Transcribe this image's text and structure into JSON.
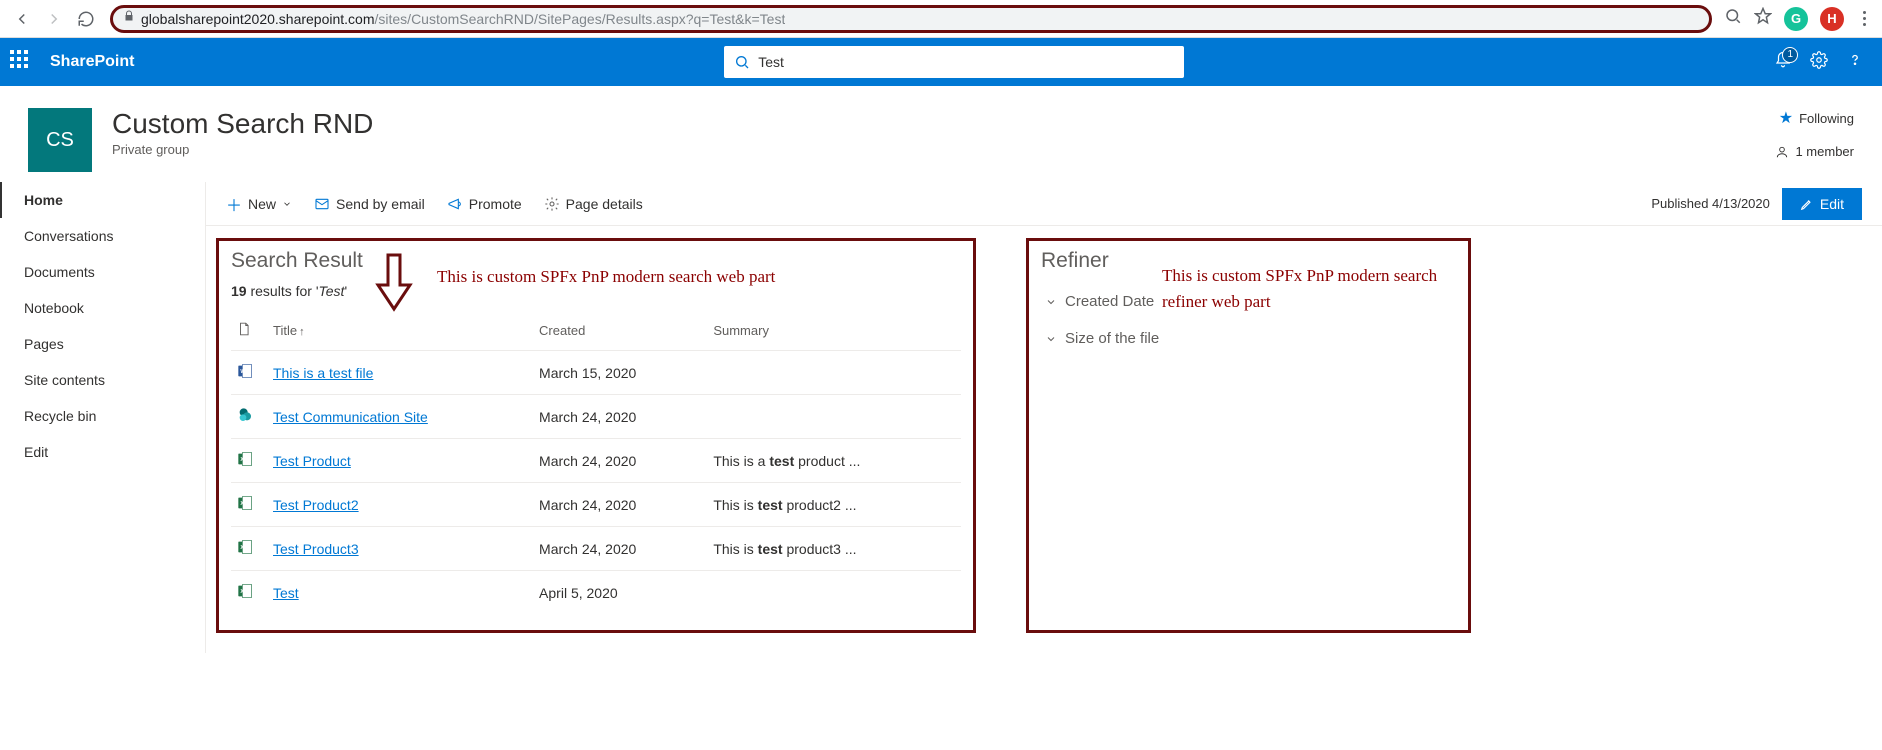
{
  "browser": {
    "url_host": "globalsharepoint2020.sharepoint.com",
    "url_path": "/sites/CustomSearchRND/SitePages/Results.aspx?q=Test&k=Test",
    "ext_g": "G",
    "ext_h": "H"
  },
  "suite": {
    "brand": "SharePoint",
    "search_value": "Test",
    "notif_count": "1"
  },
  "site": {
    "logo_initials": "CS",
    "title": "Custom Search RND",
    "subtitle": "Private group",
    "following": "Following",
    "members": "1 member"
  },
  "leftnav": {
    "items": [
      "Home",
      "Conversations",
      "Documents",
      "Notebook",
      "Pages",
      "Site contents",
      "Recycle bin",
      "Edit"
    ],
    "active_index": 0
  },
  "commandbar": {
    "new": "New",
    "send": "Send by email",
    "promote": "Promote",
    "page_details": "Page details",
    "published": "Published 4/13/2020",
    "edit": "Edit"
  },
  "search_results": {
    "panel_title": "Search Result",
    "count": "19",
    "results_prefix": "results for",
    "query": "Test",
    "annotation": "This is custom SPFx PnP modern search web part",
    "headers": {
      "title": "Title",
      "created": "Created",
      "summary": "Summary"
    },
    "rows": [
      {
        "icon": "word",
        "title": "This is a test file",
        "created": "March 15, 2020",
        "summary": ""
      },
      {
        "icon": "sp",
        "title": "Test Communication Site",
        "created": "March 24, 2020",
        "summary": ""
      },
      {
        "icon": "excel",
        "title": "Test Product",
        "created": "March 24, 2020",
        "summary": "This is a test product ..."
      },
      {
        "icon": "excel",
        "title": "Test Product2",
        "created": "March 24, 2020",
        "summary": "This is test product2 ..."
      },
      {
        "icon": "excel",
        "title": "Test Product3",
        "created": "March 24, 2020",
        "summary": "This is test product3 ..."
      },
      {
        "icon": "excel",
        "title": "Test",
        "created": "April 5, 2020",
        "summary": ""
      }
    ]
  },
  "refiner": {
    "panel_title": "Refiner",
    "annotation": "This is custom SPFx PnP modern search refiner web part",
    "items": [
      "Created Date",
      "Size of the file"
    ]
  }
}
